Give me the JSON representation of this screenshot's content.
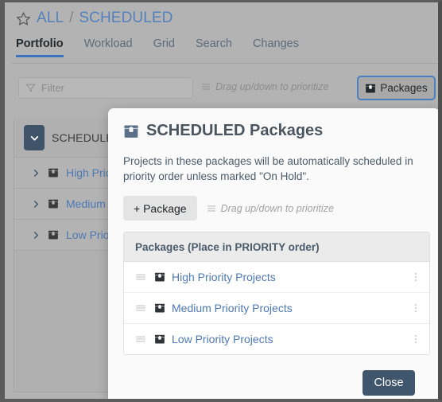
{
  "breadcrumb": {
    "star_icon": "star-outline-icon",
    "root": "ALL",
    "separator": "/",
    "current": "SCHEDULED"
  },
  "tabs": [
    {
      "label": "Portfolio",
      "active": true
    },
    {
      "label": "Workload",
      "active": false
    },
    {
      "label": "Grid",
      "active": false
    },
    {
      "label": "Search",
      "active": false
    },
    {
      "label": "Changes",
      "active": false
    }
  ],
  "toolbar": {
    "filter_placeholder": "Filter",
    "filter_value": "",
    "filter_icon": "funnel-icon",
    "drag_hint": "Drag up/down to prioritize",
    "drag_hint_icon": "bars-icon",
    "packages_button": "Packages",
    "packages_button_icon": "box-icon"
  },
  "background_panel": {
    "group_label": "SCHEDULED",
    "caret_icon": "chevron-down-icon",
    "rows": [
      {
        "label": "High Priority Projects",
        "expand_icon": "chevron-right-icon",
        "icon": "box-icon"
      },
      {
        "label": "Medium Priority Projects",
        "expand_icon": "chevron-right-icon",
        "icon": "box-icon"
      },
      {
        "label": "Low Priority Projects",
        "expand_icon": "chevron-right-icon",
        "icon": "box-icon"
      }
    ]
  },
  "modal": {
    "title": "SCHEDULED Packages",
    "title_icon": "box-icon",
    "description": "Projects in these packages will be automatically scheduled in priority order unless marked \"On Hold\".",
    "add_package_button": "+ Package",
    "drag_hint": "Drag up/down to prioritize",
    "drag_hint_icon": "bars-icon",
    "table": {
      "header": "Packages (Place in PRIORITY order)",
      "rows": [
        {
          "name": "High Priority Projects",
          "handle_icon": "drag-handle-icon",
          "icon": "box-icon",
          "menu_icon": "kebab-menu-icon"
        },
        {
          "name": "Medium Priority Projects",
          "handle_icon": "drag-handle-icon",
          "icon": "box-icon",
          "menu_icon": "kebab-menu-icon"
        },
        {
          "name": "Low Priority Projects",
          "handle_icon": "drag-handle-icon",
          "icon": "box-icon",
          "menu_icon": "kebab-menu-icon"
        }
      ]
    },
    "close_button": "Close"
  },
  "colors": {
    "accent_blue": "#4d79b5",
    "tab_underline": "#3b74bd",
    "close_button_bg": "#3f566d",
    "focus_ring": "#4a7fc1",
    "header_text": "#4b5560"
  }
}
